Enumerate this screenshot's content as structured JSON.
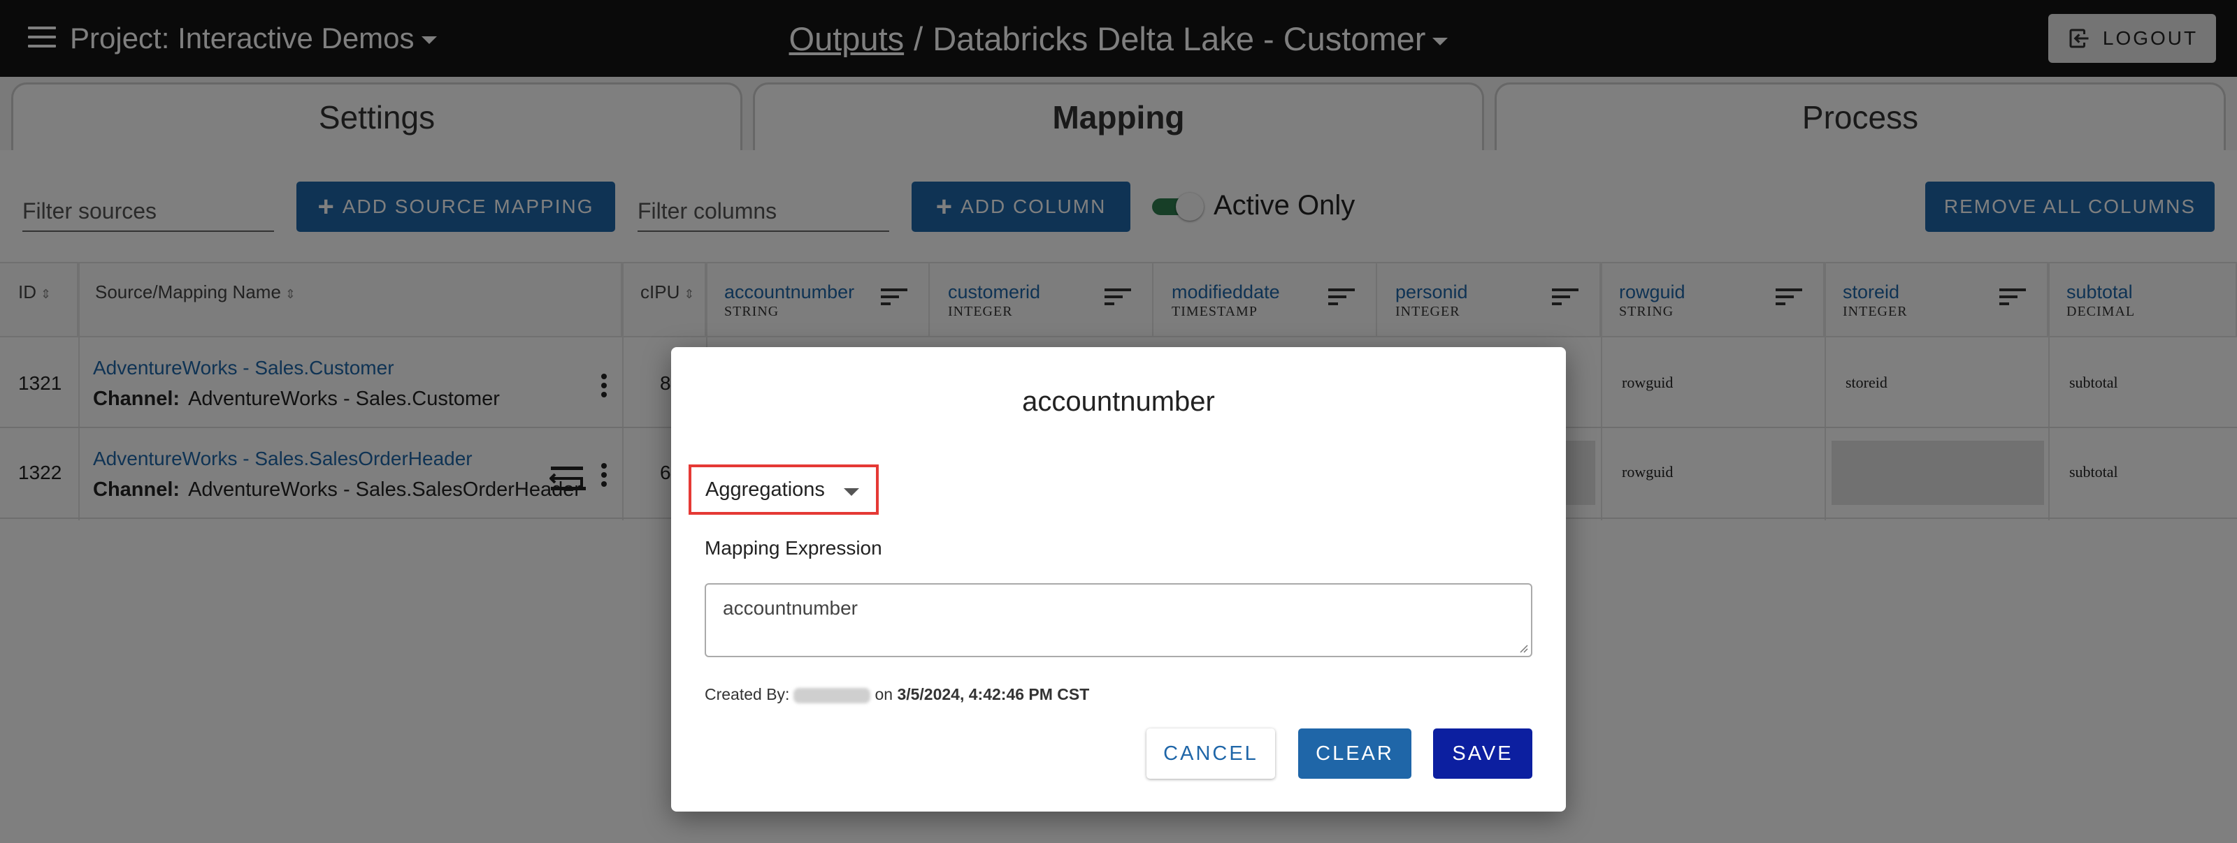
{
  "header": {
    "project_label": "Project:",
    "project_name": "Interactive Demos",
    "breadcrumb_root": "Outputs",
    "breadcrumb_separator": "/",
    "breadcrumb_current": "Databricks Delta Lake - Customer",
    "logout_label": "LOGOUT"
  },
  "tabs": [
    {
      "label": "Settings",
      "active": false
    },
    {
      "label": "Mapping",
      "active": true
    },
    {
      "label": "Process",
      "active": false
    }
  ],
  "toolbar": {
    "filter_sources_placeholder": "Filter sources",
    "add_source_mapping_label": "ADD SOURCE MAPPING",
    "filter_columns_placeholder": "Filter columns",
    "add_column_label": "ADD COLUMN",
    "active_only_label": "Active Only",
    "active_only_on": true,
    "remove_all_columns_label": "REMOVE ALL COLUMNS"
  },
  "table": {
    "headers": {
      "id": "ID",
      "source": "Source/Mapping Name",
      "cpu": "cIPU"
    },
    "columns": [
      {
        "name": "accountnumber",
        "type": "STRING"
      },
      {
        "name": "customerid",
        "type": "INTEGER"
      },
      {
        "name": "modifieddate",
        "type": "TIMESTAMP"
      },
      {
        "name": "personid",
        "type": "INTEGER"
      },
      {
        "name": "rowguid",
        "type": "STRING"
      },
      {
        "name": "storeid",
        "type": "INTEGER"
      },
      {
        "name": "subtotal",
        "type": "DECIMAL"
      }
    ],
    "rows": [
      {
        "id": "1321",
        "source": "AdventureWorks - Sales.Customer",
        "channel_label": "Channel:",
        "channel": "AdventureWorks - Sales.Customer",
        "cpu": "8",
        "rowguid": "rowguid",
        "storeid": "storeid",
        "subtotal": "subtotal"
      },
      {
        "id": "1322",
        "source": "AdventureWorks - Sales.SalesOrderHeader",
        "channel_label": "Channel:",
        "channel": "AdventureWorks - Sales.SalesOrderHeader",
        "cpu": "6",
        "rowguid": "rowguid",
        "subtotal": "subtotal"
      }
    ]
  },
  "dialog": {
    "title": "accountnumber",
    "aggregations_label": "Aggregations",
    "mapping_expression_label": "Mapping Expression",
    "mapping_expression_value": "accountnumber",
    "created_by_label": "Created By:",
    "created_on_label": "on",
    "created_timestamp": "3/5/2024, 4:42:46 PM CST",
    "cancel_label": "CANCEL",
    "clear_label": "CLEAR",
    "save_label": "SAVE"
  },
  "colors": {
    "topbar": "#141414",
    "primary_button": "#1f66a8",
    "save_button": "#0c1fa0",
    "highlight_border": "#e53935",
    "toggle_on": "#2e7d4f",
    "link": "#1f66a8"
  }
}
